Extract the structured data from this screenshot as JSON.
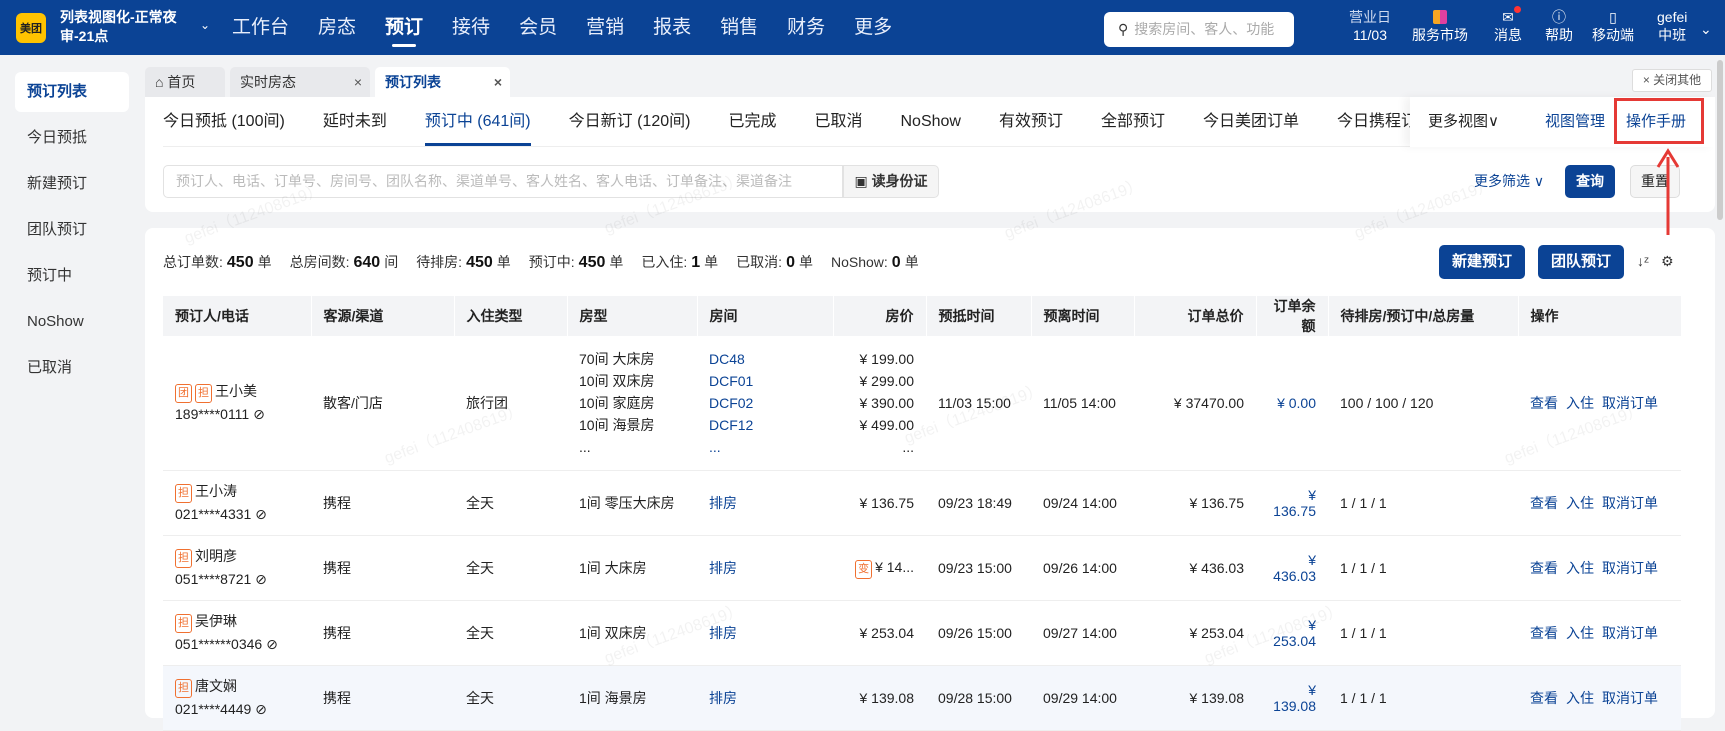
{
  "nav": {
    "logo": "美团",
    "hotel": "列表视图化-正常夜审-21点",
    "items": [
      "工作台",
      "房态",
      "预订",
      "接待",
      "会员",
      "营销",
      "报表",
      "销售",
      "财务",
      "更多"
    ],
    "active": "预订",
    "search_placeholder": "搜索房间、客人、功能",
    "biz_day_label": "营业日",
    "biz_day": "11/03",
    "market": "服务市场",
    "messages": "消息",
    "help": "帮助",
    "mobile": "移动端",
    "user": "gefei",
    "shift": "中班"
  },
  "sidebar": {
    "items": [
      "预订列表",
      "今日预抵",
      "新建预订",
      "团队预订",
      "预订中",
      "NoShow",
      "已取消"
    ]
  },
  "tabs": [
    {
      "label": "首页"
    },
    {
      "label": "实时房态"
    },
    {
      "label": "预订列表"
    }
  ],
  "close_others": "× 关闭其他",
  "view_tabs": [
    "今日预抵 (100间)",
    "延时未到",
    "预订中 (641间)",
    "今日新订 (120间)",
    "已完成",
    "已取消",
    "NoShow",
    "有效预订",
    "全部预订",
    "今日美团订单",
    "今日携程订单"
  ],
  "more_views": "更多视图∨",
  "view_manage": "视图管理",
  "manual": "操作手册",
  "search": {
    "placeholder": "预订人、电话、订单号、房间号、团队名称、渠道单号、客人姓名、客人电话、订单备注、渠道备注",
    "read_id": "读身份证",
    "more_filter": "更多筛选 ∨",
    "query": "查询",
    "reset": "重置"
  },
  "stats": [
    {
      "label": "总订单数:",
      "value": "450",
      "unit": "单"
    },
    {
      "label": "总房间数:",
      "value": "640",
      "unit": "间"
    },
    {
      "label": "待排房:",
      "value": "450",
      "unit": "单"
    },
    {
      "label": "预订中:",
      "value": "450",
      "unit": "单"
    },
    {
      "label": "已入住:",
      "value": "1",
      "unit": "单"
    },
    {
      "label": "已取消:",
      "value": "0",
      "unit": "单"
    },
    {
      "label": "NoShow:",
      "value": "0",
      "unit": "单"
    }
  ],
  "buttons": {
    "new": "新建预订",
    "group": "团队预订"
  },
  "columns": [
    "预订人/电话",
    "客源/渠道",
    "入住类型",
    "房型",
    "房间",
    "房价",
    "预抵时间",
    "预离时间",
    "订单总价",
    "订单余额",
    "待排房/预订中/总房量",
    "操作"
  ],
  "rows": [
    {
      "tags": [
        "团",
        "担"
      ],
      "name": "王小美",
      "phone": "189****0111",
      "channel": "散客/门店",
      "type": "旅行团",
      "rooms": [
        "70间 大床房",
        "10间 双床房",
        "10间 家庭房",
        "10间 海景房",
        "..."
      ],
      "room_nos": [
        "DC48",
        "DCF01",
        "DCF02",
        "DCF12",
        "..."
      ],
      "prices": [
        "¥ 199.00",
        "¥ 299.00",
        "¥ 390.00",
        "¥ 499.00",
        "..."
      ],
      "arrive": "11/03 15:00",
      "depart": "11/05 14:00",
      "total": "¥ 37470.00",
      "balance": "¥ 0.00",
      "counts": "100 / 100 / 120"
    },
    {
      "tags": [
        "担"
      ],
      "name": "王小涛",
      "phone": "021****4331",
      "channel": "携程",
      "type": "全天",
      "rooms": [
        "1间 零压大床房"
      ],
      "room_nos": [
        "排房"
      ],
      "prices": [
        "¥ 136.75"
      ],
      "arrive": "09/23 18:49",
      "depart": "09/24 14:00",
      "total": "¥ 136.75",
      "balance": "¥ 136.75",
      "counts": "1 / 1 / 1"
    },
    {
      "tags": [
        "担"
      ],
      "name": "刘明彦",
      "phone": "051****8721",
      "channel": "携程",
      "type": "全天",
      "rooms": [
        "1间 大床房"
      ],
      "room_nos": [
        "排房"
      ],
      "price_tag": "变",
      "prices": [
        "¥ 14..."
      ],
      "arrive": "09/23 15:00",
      "depart": "09/26 14:00",
      "total": "¥ 436.03",
      "balance": "¥ 436.03",
      "counts": "1 / 1 / 1"
    },
    {
      "tags": [
        "担"
      ],
      "name": "吴伊琳",
      "phone": "051******0346",
      "channel": "携程",
      "type": "全天",
      "rooms": [
        "1间 双床房"
      ],
      "room_nos": [
        "排房"
      ],
      "prices": [
        "¥ 253.04"
      ],
      "arrive": "09/26 15:00",
      "depart": "09/27 14:00",
      "total": "¥ 253.04",
      "balance": "¥ 253.04",
      "counts": "1 / 1 / 1"
    },
    {
      "tags": [
        "担"
      ],
      "name": "唐文娴",
      "phone": "021****4449",
      "channel": "携程",
      "type": "全天",
      "rooms": [
        "1间 海景房"
      ],
      "room_nos": [
        "排房"
      ],
      "prices": [
        "¥ 139.08"
      ],
      "arrive": "09/28 15:00",
      "depart": "09/29 14:00",
      "total": "¥ 139.08",
      "balance": "¥ 139.08",
      "counts": "1 / 1 / 1"
    }
  ],
  "actions": [
    "查看",
    "入住",
    "取消订单"
  ],
  "watermark": "gefei（112408619）",
  "colors": {
    "primary": "#0b4395",
    "tag": "#f07030",
    "annotation": "#e53935"
  }
}
